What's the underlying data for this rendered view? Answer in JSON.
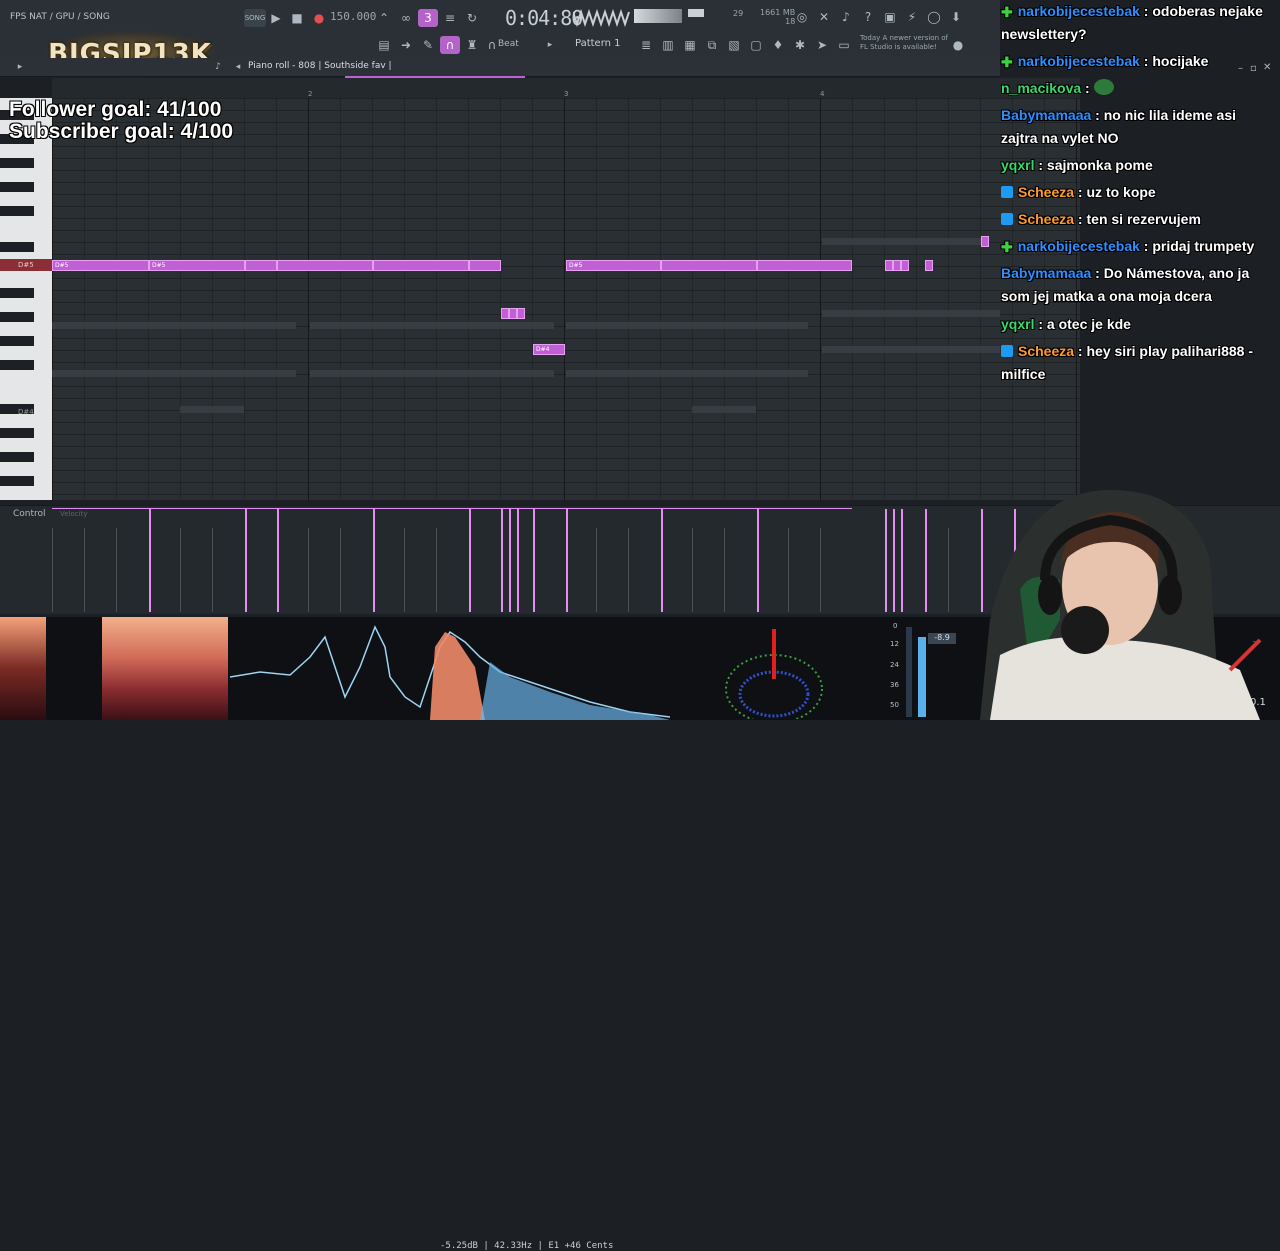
{
  "toolbar": {
    "hint": "FPS NAT / GPU / SONG",
    "bpm": "150.000",
    "clock": "0:04:80",
    "cpu_counter": "29",
    "memory": "1661 MB",
    "polyphony": "18",
    "pattern": "Pattern 1",
    "snap": "Beat",
    "news": "Today  A newer version of FL Studio is available!",
    "song_label": "SONG"
  },
  "logo": {
    "text": "BIGSIP13K"
  },
  "piano_roll": {
    "title": "Piano roll - 808 | Southside fav |",
    "key_active": "D#5",
    "key_lower": "D#4",
    "bar_labels": [
      "2",
      "3",
      "4"
    ],
    "control_label": "Control",
    "velocity_label": "Velocity",
    "note_label": "D#5",
    "note_label_low": "D#4"
  },
  "overlay": {
    "follower_goal": "Follower goal: 41/100",
    "subscriber_goal": "Subscriber goal: 4/100"
  },
  "chat": [
    {
      "user": "narkobijecestebak",
      "color": "#2f8fff",
      "badge": "plus",
      "text": "odoberas nejake newslettery?"
    },
    {
      "user": "narkobijecestebak",
      "color": "#2f8fff",
      "badge": "plus",
      "text": "hocijake"
    },
    {
      "user": "n_macikova",
      "color": "#3ad86a",
      "badge": "none",
      "text": "",
      "emote": true
    },
    {
      "user": "Babymamaaa",
      "color": "#2f8fff",
      "badge": "none",
      "text": "no nic lila ideme asi zajtra na vylet NO"
    },
    {
      "user": "yqxrl",
      "color": "#3ad86a",
      "badge": "none",
      "text": "sajmonka pome"
    },
    {
      "user": "Scheeza",
      "color": "#ff9b2e",
      "badge": "twitter",
      "text": "uz to kope"
    },
    {
      "user": "Scheeza",
      "color": "#ff9b2e",
      "badge": "twitter",
      "text": "ten si rezervujem"
    },
    {
      "user": "narkobijecestebak",
      "color": "#2f8fff",
      "badge": "plus",
      "text": "pridaj trumpety"
    },
    {
      "user": "Babymamaaa",
      "color": "#2f8fff",
      "badge": "none",
      "text": "Do Námestova, ano ja som jej matka a ona moja dcera"
    },
    {
      "user": "yqxrl",
      "color": "#3ad86a",
      "badge": "none",
      "text": "a otec je kde"
    },
    {
      "user": "Scheeza",
      "color": "#ff9b2e",
      "badge": "twitter",
      "text": "hey siri play palihari888 - milfice"
    }
  ],
  "visualizer": {
    "readout": "-5.25dB | 42.33Hz | E1 +46 Cents",
    "peak": "-8.9",
    "meter_ticks": [
      "0",
      "12",
      "24",
      "36",
      "50"
    ],
    "corner_value": "0.1",
    "corner_small": "3"
  },
  "colors": {
    "note": "#c060d4",
    "accent": "#b464c8",
    "active_key": "#8a2f36"
  }
}
